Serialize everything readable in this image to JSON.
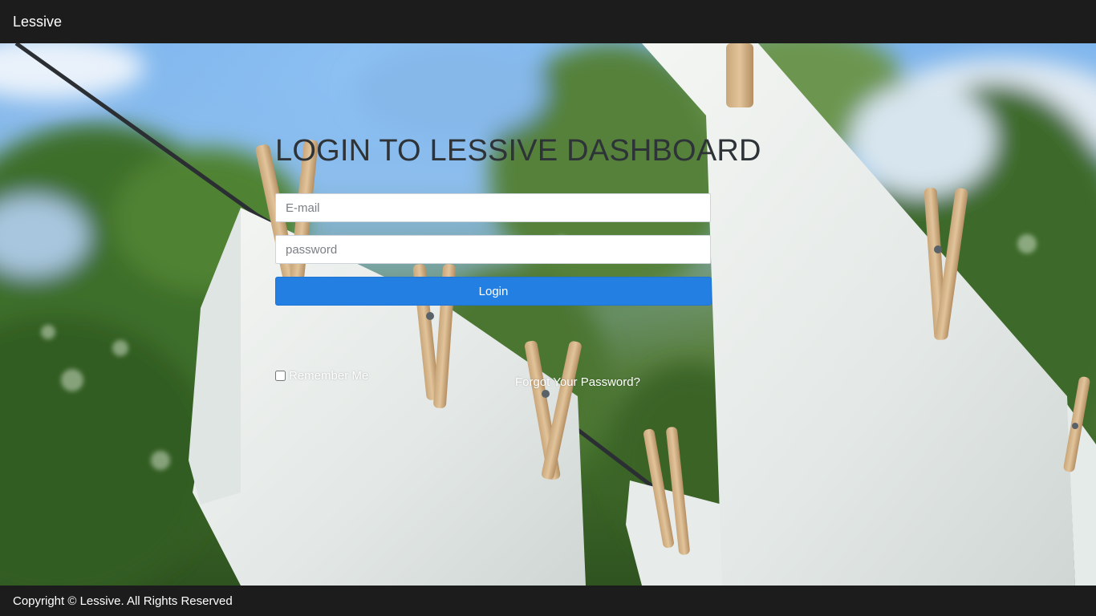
{
  "navbar": {
    "brand": "Lessive"
  },
  "login": {
    "title": "LOGIN TO LESSIVE DASHBOARD",
    "email_placeholder": "E-mail",
    "email_value": "",
    "password_placeholder": "password",
    "password_value": "",
    "login_label": "Login",
    "remember_label": "Remember Me",
    "remember_checked": false,
    "forgot_label": "Forgot Your Password?",
    "button_color": "#2380e2"
  },
  "footer": {
    "copyright": "Copyright © Lessive. All Rights Reserved"
  },
  "background": {
    "image_subject": "laundry-on-clothesline-photo"
  }
}
